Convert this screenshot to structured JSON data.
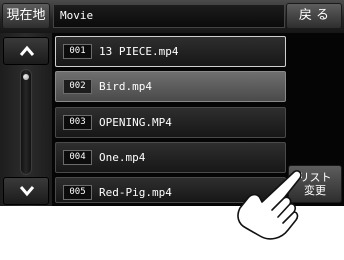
{
  "header": {
    "current_location_label": "現在地",
    "title": "Movie",
    "back_label": "戻 る"
  },
  "files": [
    {
      "number": "001",
      "name": "13 PIECE.mp4"
    },
    {
      "number": "002",
      "name": "Bird.mp4"
    },
    {
      "number": "003",
      "name": "OPENING.MP4"
    },
    {
      "number": "004",
      "name": "One.mp4"
    },
    {
      "number": "005",
      "name": "Red-Pig.mp4"
    }
  ],
  "list_change": {
    "line1": "リスト",
    "line2": "変更"
  },
  "icons": {
    "scroll_up": "chevron-up-icon",
    "scroll_down": "chevron-down-icon",
    "pointer": "hand-pointer-icon"
  },
  "colors": {
    "screen_background": "#050505",
    "highlighted_row": "#5c5c5c",
    "selected_border": "#cfcfcf"
  }
}
